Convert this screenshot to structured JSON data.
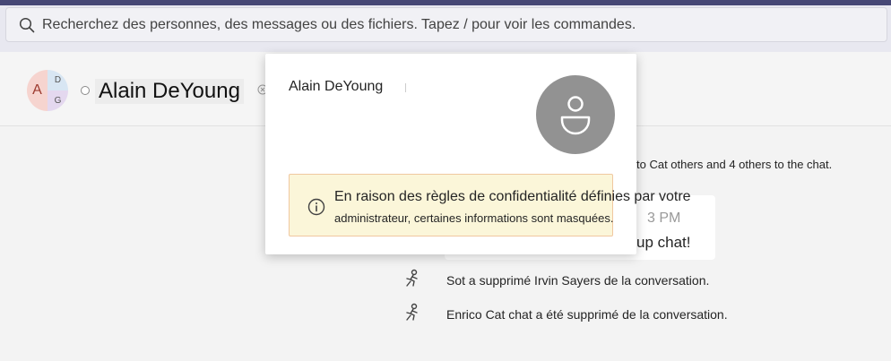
{
  "search": {
    "placeholder": "Recherchez des personnes, des messages ou des fichiers. Tapez / pour voir les commandes."
  },
  "chat_header": {
    "title": "Alain DeYoung",
    "avatar_initials": {
      "main": "A",
      "top": "D",
      "bottom": "G"
    }
  },
  "timeline": {
    "added_text": "to Cat others and 4 others to the chat.",
    "message_time": "3 PM",
    "message_text": "up chat!",
    "events": [
      {
        "text": "Sot a supprimé Irvin Sayers de la conversation.",
        "icon": "person-leave-icon"
      },
      {
        "text": "Enrico Cat chat a été supprimé de la conversation.",
        "icon": "person-leave-icon"
      }
    ]
  },
  "profile_card": {
    "name": "Alain DeYoung",
    "notice_line1": "En raison des règles de confidentialité définies par votre",
    "notice_line2": "administrateur, certaines informations sont masquées."
  },
  "colors": {
    "brand": "#464775",
    "notice_bg": "#fbf6d9",
    "notice_border": "#f0c8a0",
    "avatar_gray": "#929292"
  }
}
